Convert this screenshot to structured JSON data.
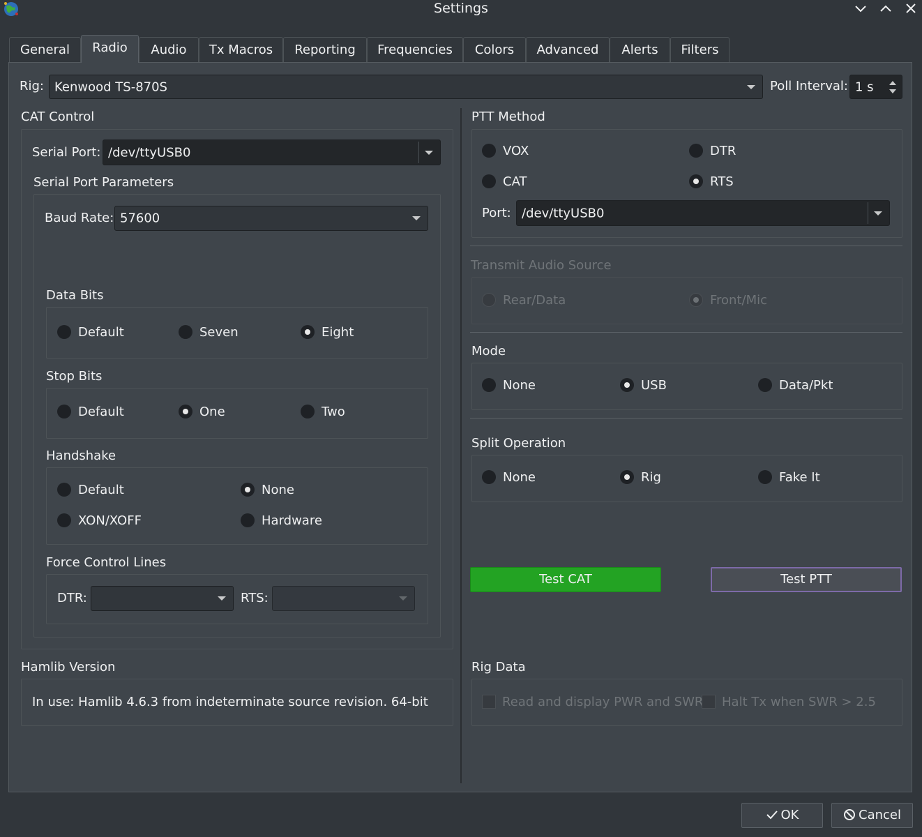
{
  "window": {
    "title": "Settings"
  },
  "tabs": [
    {
      "label": "General"
    },
    {
      "label": "Radio"
    },
    {
      "label": "Audio"
    },
    {
      "label": "Tx Macros"
    },
    {
      "label": "Reporting"
    },
    {
      "label": "Frequencies"
    },
    {
      "label": "Colors"
    },
    {
      "label": "Advanced"
    },
    {
      "label": "Alerts"
    },
    {
      "label": "Filters"
    }
  ],
  "rig": {
    "label": "Rig:",
    "value": "Kenwood TS-870S",
    "poll_label": "Poll Interval:",
    "poll_value": "1 s"
  },
  "cat": {
    "title": "CAT Control",
    "serial_port_label": "Serial Port:",
    "serial_port_value": "/dev/ttyUSB0",
    "params_title": "Serial Port Parameters",
    "baud_label": "Baud Rate:",
    "baud_value": "57600",
    "data_bits": {
      "title": "Data Bits",
      "opt1": "Default",
      "opt2": "Seven",
      "opt3": "Eight"
    },
    "stop_bits": {
      "title": "Stop Bits",
      "opt1": "Default",
      "opt2": "One",
      "opt3": "Two"
    },
    "handshake": {
      "title": "Handshake",
      "opt1": "Default",
      "opt2": "None",
      "opt3": "XON/XOFF",
      "opt4": "Hardware"
    },
    "force": {
      "title": "Force Control Lines",
      "dtr_label": "DTR:",
      "rts_label": "RTS:"
    }
  },
  "hamlib": {
    "title": "Hamlib Version",
    "text": "In use:  Hamlib 4.6.3 from indeterminate source revision. 64-bit"
  },
  "ptt": {
    "title": "PTT Method",
    "vox": "VOX",
    "dtr": "DTR",
    "cat": "CAT",
    "rts": "RTS",
    "port_label": "Port:",
    "port_value": "/dev/ttyUSB0"
  },
  "tx_audio": {
    "title": "Transmit Audio Source",
    "rear": "Rear/Data",
    "front": "Front/Mic"
  },
  "mode": {
    "title": "Mode",
    "none": "None",
    "usb": "USB",
    "data": "Data/Pkt"
  },
  "split": {
    "title": "Split Operation",
    "none": "None",
    "rig": "Rig",
    "fake": "Fake It"
  },
  "buttons": {
    "test_cat": "Test CAT",
    "test_ptt": "Test PTT",
    "ok": "OK",
    "cancel": "Cancel"
  },
  "rig_data": {
    "title": "Rig Data",
    "read_pwr": "Read and display PWR and SWR",
    "halt_tx": "Halt Tx when SWR > 2.5"
  },
  "colors": {
    "accent_green": "#23a323",
    "ptt_border": "#7d6aa8",
    "background": "#31363b"
  }
}
